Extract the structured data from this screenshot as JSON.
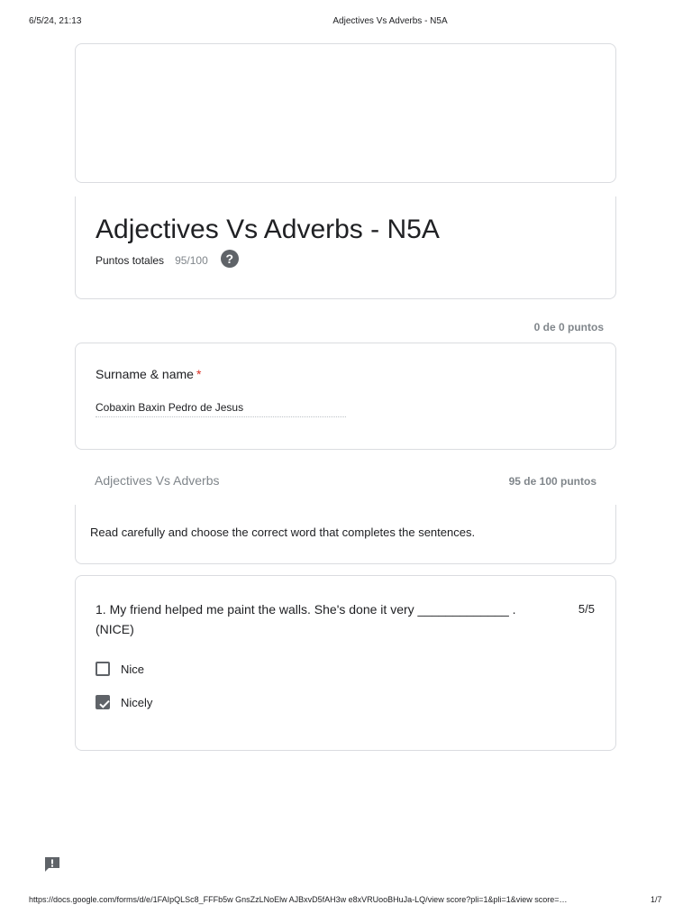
{
  "print_header": {
    "date": "6/5/24, 21:13",
    "title": "Adjectives Vs Adverbs - N5A"
  },
  "form": {
    "title": "Adjectives Vs Adverbs - N5A",
    "total_points_label": "Puntos totales",
    "total_points_value": "95/100",
    "help_icon": "help-circle-icon"
  },
  "section_1": {
    "points": "0 de 0 puntos",
    "question": {
      "label": "Surname & name",
      "required_marker": "*",
      "answer": "Cobaxin Baxin Pedro de Jesus"
    }
  },
  "section_2": {
    "title": "Adjectives Vs Adverbs",
    "points": "95 de 100 puntos",
    "description": "Read carefully and choose the correct word that completes the sentences."
  },
  "question_1": {
    "text": "1. My friend helped me paint the walls. She's done it very _____________ . (NICE)",
    "score": "5/5",
    "options": [
      {
        "label": "Nice",
        "checked": false
      },
      {
        "label": "Nicely",
        "checked": true
      }
    ]
  },
  "feedback_icon": "feedback-icon",
  "print_footer": {
    "url": "https://docs.google.com/forms/d/e/1FAIpQLSc8_FFFb5w GnsZzLNoElw AJBxvD5fAH3w e8xVRUooBHuJa-LQ/view score?pli=1&pli=1&view score=…",
    "page": "1/7"
  },
  "colors": {
    "border": "#dadce0",
    "muted": "#80868b",
    "required": "#d93025",
    "checkbox": "#5f6368"
  }
}
